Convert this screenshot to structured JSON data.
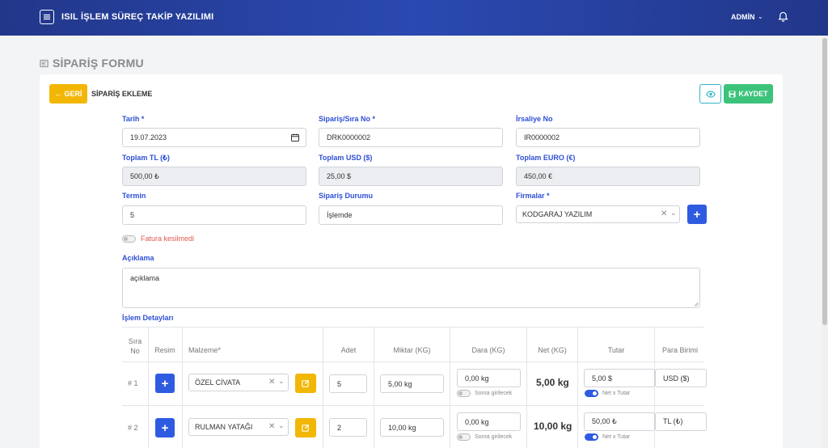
{
  "header": {
    "app_title": "ISIL İŞLEM SÜREÇ TAKİP YAZILIMI",
    "user": "ADMİN"
  },
  "page": {
    "title": "SİPARİŞ FORMU"
  },
  "card": {
    "back_label": "GERİ",
    "title": "SİPARİŞ EKLEME",
    "save_label": "KAYDET"
  },
  "form": {
    "tarih": {
      "label": "Tarih *",
      "value": "19.07.2023"
    },
    "siparis_no": {
      "label": "Sipariş/Sıra No *",
      "value": "DRK0000002"
    },
    "irsaliye_no": {
      "label": "İrsaliye No",
      "value": "IR0000002"
    },
    "toplam_tl": {
      "label": "Toplam TL (₺)",
      "value": "500,00 ₺"
    },
    "toplam_usd": {
      "label": "Toplam USD ($)",
      "value": "25,00 $"
    },
    "toplam_euro": {
      "label": "Toplam EURO (€)",
      "value": "450,00 €"
    },
    "termin": {
      "label": "Termin",
      "value": "5"
    },
    "siparis_durumu": {
      "label": "Sipariş Durumu",
      "value": "İşlemde"
    },
    "firmalar": {
      "label": "Firmalar *",
      "value": "KODGARAJ YAZILIM"
    },
    "fatura_toggle": {
      "label": "Fatura kesilmedi",
      "on": false
    },
    "aciklama": {
      "label": "Açıklama",
      "value": "açıklama"
    }
  },
  "details": {
    "label": "İşlem Detayları",
    "columns": {
      "sira_no": "Sıra No",
      "resim": "Resim",
      "malzeme": "Malzeme*",
      "adet": "Adet",
      "miktar": "Miktar (KG)",
      "dara": "Dara (KG)",
      "net": "Net (KG)",
      "tutar": "Tutar",
      "para_birimi": "Para Birimi"
    },
    "rows": [
      {
        "no": "# 1",
        "malzeme": "ÖZEL CİVATA",
        "adet": "5",
        "miktar": "5,00 kg",
        "dara": "0,00 kg",
        "dara_note": "Sonra girilecek",
        "net": "5,00 kg",
        "tutar": "5,00 $",
        "tutar_note": "Net x Tutar",
        "para_birimi": "USD ($)"
      },
      {
        "no": "# 2",
        "malzeme": "RULMAN YATAĞI",
        "adet": "2",
        "miktar": "10,00 kg",
        "dara": "0,00 kg",
        "dara_note": "Sonra girilecek",
        "net": "10,00 kg",
        "tutar": "50,00 ₺",
        "tutar_note": "Net x Tutar",
        "para_birimi": "TL (₺)"
      }
    ]
  },
  "colors": {
    "navbar": "#2a49b1",
    "primary": "#2e5be0",
    "warning": "#f2b705",
    "success": "#3cc37a",
    "info": "#35b4c9",
    "danger": "#e4584e"
  }
}
